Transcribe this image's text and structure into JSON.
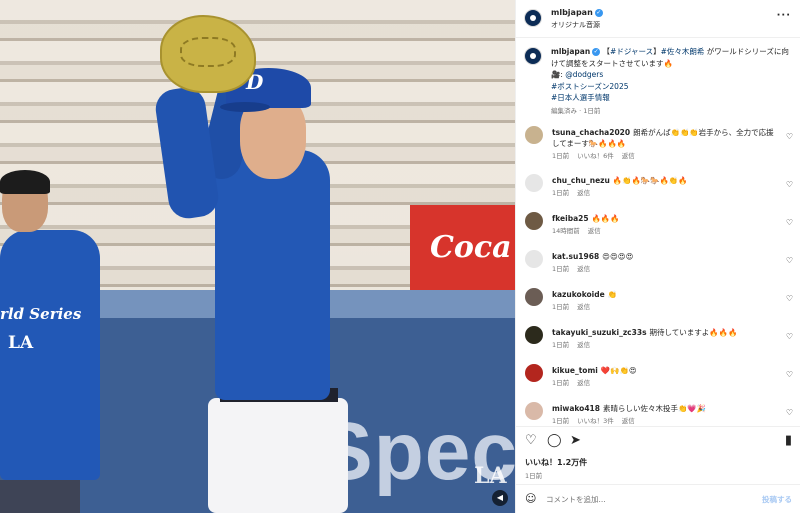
{
  "header": {
    "username": "mlbjapan",
    "subtitle": "オリジナル音源",
    "more_icon": "more-horizontal-icon"
  },
  "caption": {
    "username": "mlbjapan",
    "text_parts": {
      "p1": "【",
      "tag1": "#ドジャース",
      "p2": "】",
      "tag2": "#佐々木朗希",
      "p3": " がワールドシリーズに向けて調整をスタートさせています🔥",
      "icon_line": "🎥:",
      "mention": "@dodgers",
      "tag3": "#ポストシーズン2025",
      "tag4": "#日本人選手情報"
    },
    "meta": "編集済み · 1日前"
  },
  "comments": [
    {
      "username": "tsuna_chacha2020",
      "text": "朗希がんば👏👏👏岩手から、全力で応援してまーす🐎🔥🔥🔥",
      "time": "1日前",
      "likes": "いいね！6件",
      "reply": "返信"
    },
    {
      "username": "chu_chu_nezu",
      "text": "🔥👏🔥🐎🐎🔥👏🔥",
      "time": "1日前",
      "likes": "",
      "reply": "返信"
    },
    {
      "username": "fkeiba25",
      "text": "🔥🔥🔥",
      "time": "14時間前",
      "likes": "",
      "reply": "返信"
    },
    {
      "username": "kat.su1968",
      "text": "😍😍😍😍",
      "time": "1日前",
      "likes": "",
      "reply": "返信"
    },
    {
      "username": "kazukokoide",
      "text": "👏",
      "time": "1日前",
      "likes": "",
      "reply": "返信"
    },
    {
      "username": "takayuki_suzuki_zc33s",
      "text": "期待していますよ🔥🔥🔥",
      "time": "1日前",
      "likes": "",
      "reply": "返信"
    },
    {
      "username": "kikue_tomi",
      "text": "❤️🙌👏😍",
      "time": "1日前",
      "likes": "",
      "reply": "返信"
    },
    {
      "username": "miwako418",
      "text": "素晴らしい佐々木投手👏💗🎉",
      "time": "1日前",
      "likes": "いいね！3件",
      "reply": "返信"
    }
  ],
  "actions": {
    "like_icon": "heart-icon",
    "comment_icon": "comment-icon",
    "share_icon": "share-icon",
    "save_icon": "bookmark-icon",
    "likes": "いいね！1.2万件",
    "date": "1日前"
  },
  "add_comment": {
    "placeholder": "コメントを追加...",
    "post_label": "投稿する"
  },
  "photo": {
    "sign_text": "Coca",
    "wall_text": "Spec",
    "shirt_text": "rld Series",
    "cap_logo": "D",
    "shirt_logo": "LA",
    "watermark": "LA"
  },
  "colors": {
    "accent": "#3897f0",
    "link": "#00376b",
    "dodger_blue": "#2358b5"
  }
}
